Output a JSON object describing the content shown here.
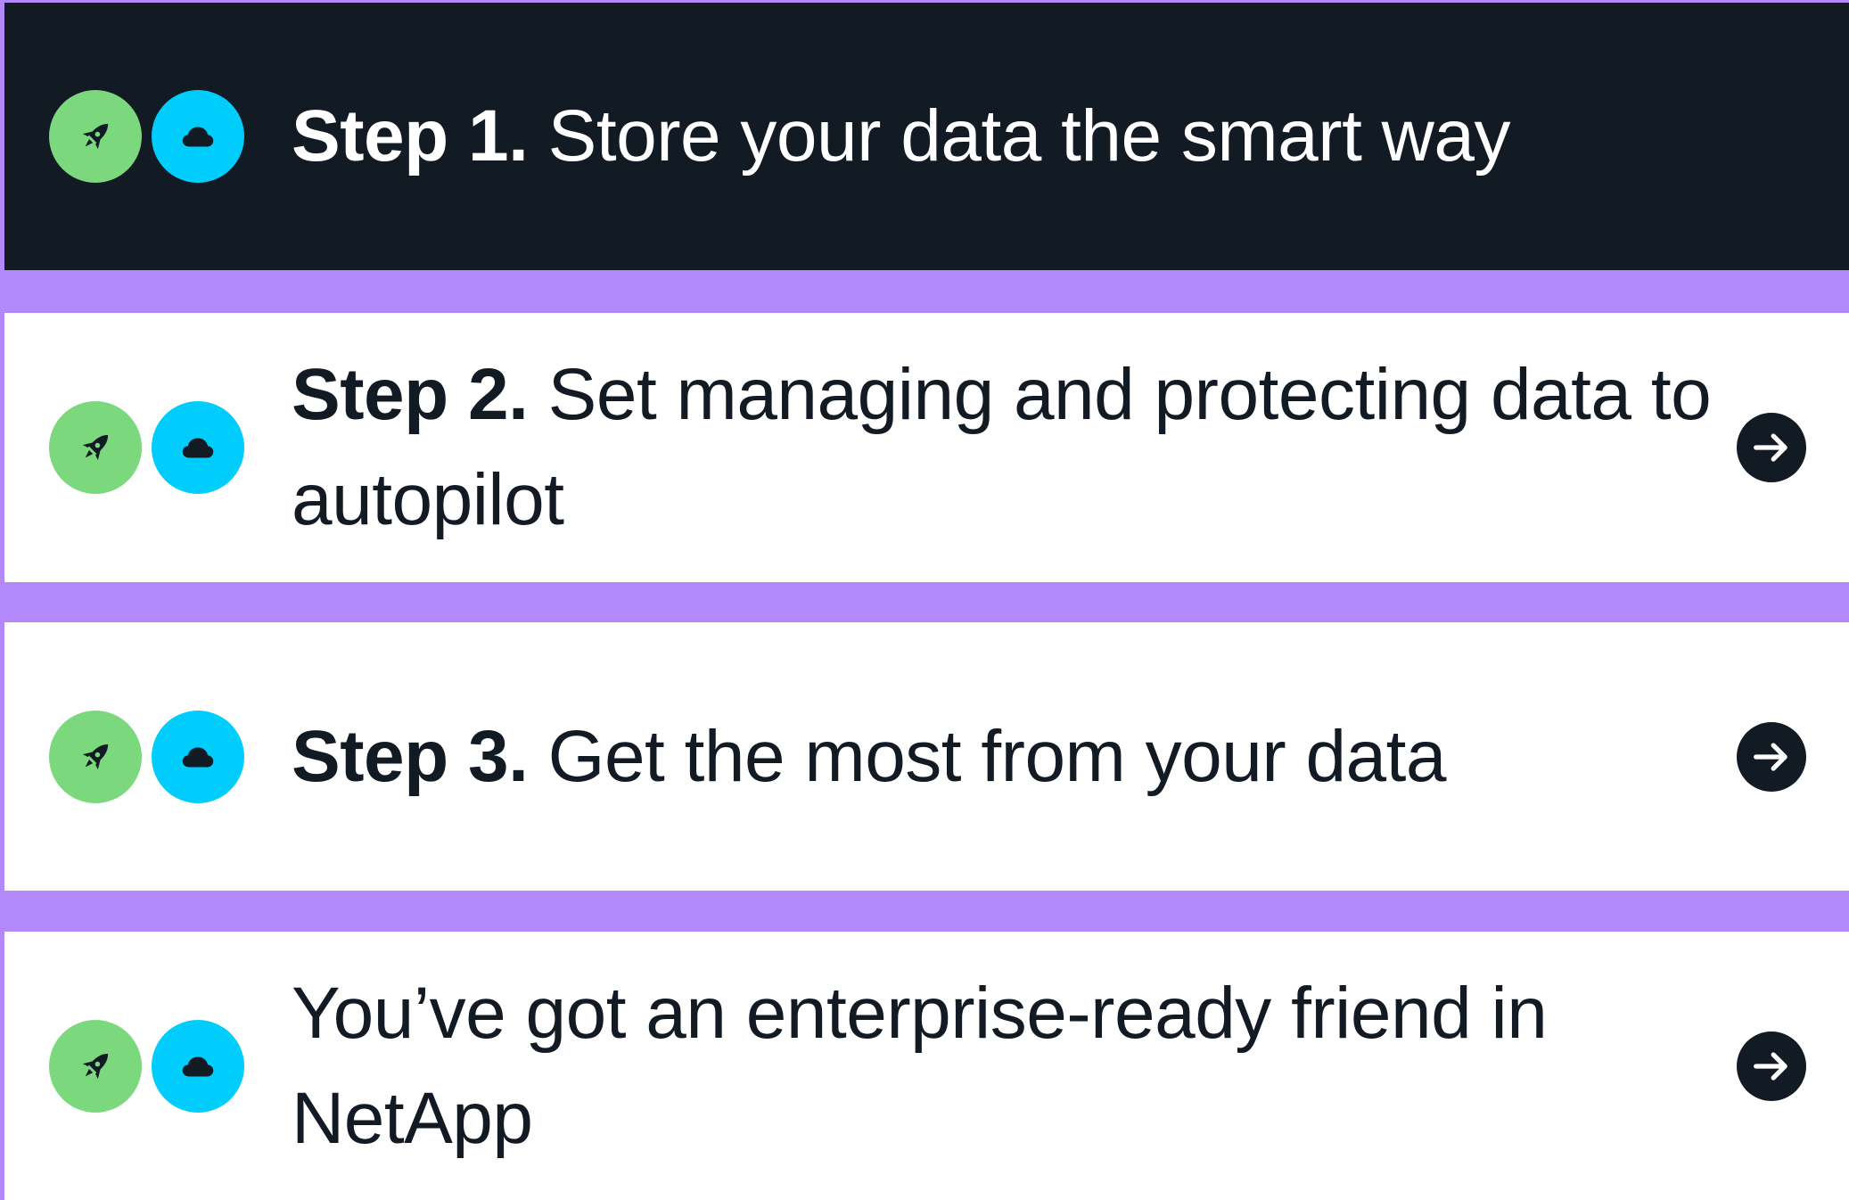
{
  "colors": {
    "background_accent": "#b388fb",
    "active_row": "#121a24",
    "inactive_row": "#ffffff",
    "rocket_badge": "#7bd87d",
    "cloud_badge": "#00cdfb",
    "text_dark": "#121a24",
    "text_light": "#ffffff"
  },
  "steps": [
    {
      "prefix": "Step 1.",
      "text": " Store your data the smart way",
      "active": true,
      "icons": [
        "rocket-icon",
        "cloud-icon"
      ],
      "has_arrow": false
    },
    {
      "prefix": "Step 2.",
      "text": " Set managing and protecting data to autopilot",
      "active": false,
      "icons": [
        "rocket-icon",
        "cloud-icon"
      ],
      "has_arrow": true
    },
    {
      "prefix": "Step 3.",
      "text": " Get the most from your data",
      "active": false,
      "icons": [
        "rocket-icon",
        "cloud-icon"
      ],
      "has_arrow": true
    },
    {
      "prefix": "",
      "text": "You’ve got an enterprise-ready friend in NetApp",
      "active": false,
      "icons": [
        "rocket-icon",
        "cloud-icon"
      ],
      "has_arrow": true
    }
  ]
}
